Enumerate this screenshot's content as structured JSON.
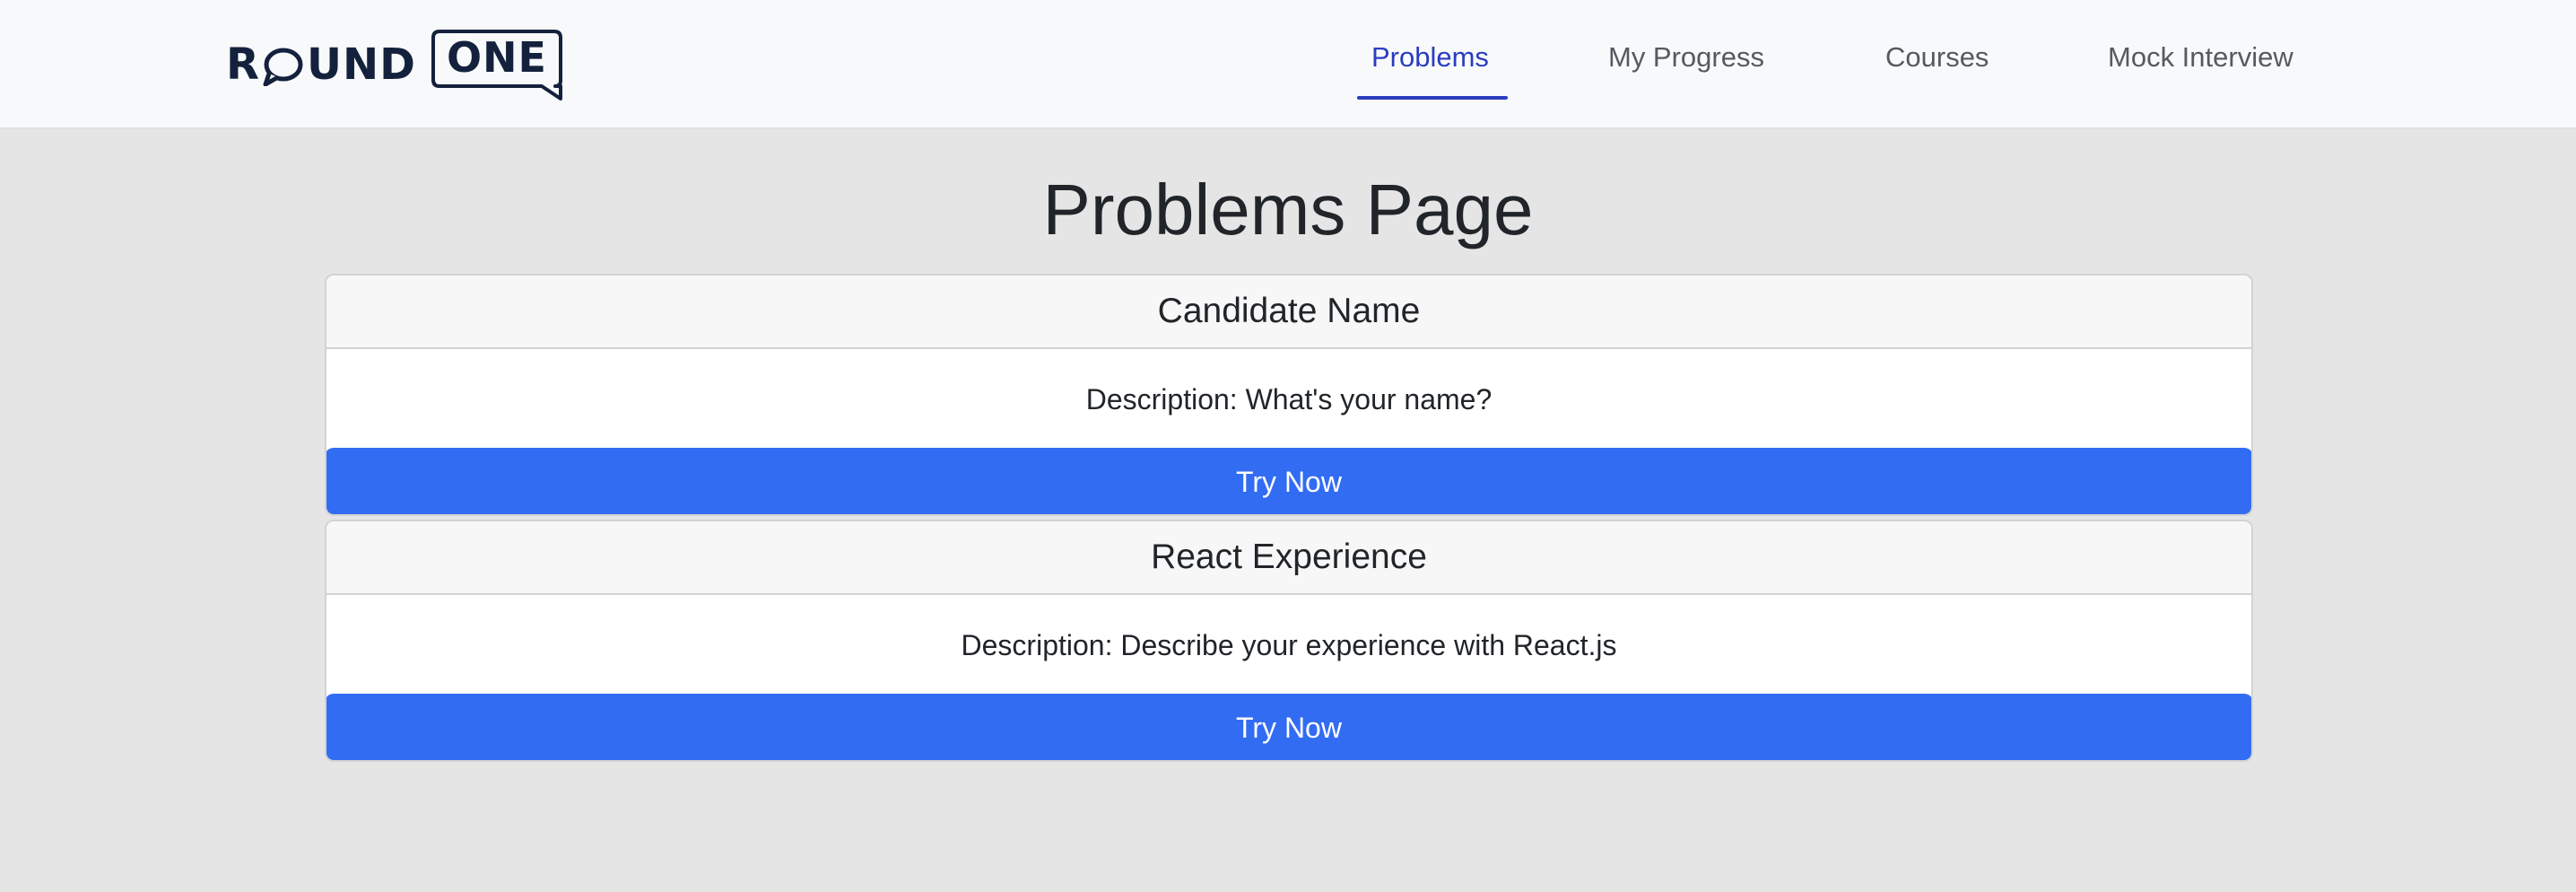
{
  "navbar": {
    "logo": {
      "word_1": "R",
      "word_1_rest": "UND",
      "word_2": "ONE"
    },
    "links": [
      {
        "label": "Problems",
        "active": true
      },
      {
        "label": "My Progress",
        "active": false
      },
      {
        "label": "Courses",
        "active": false
      },
      {
        "label": "Mock Interview",
        "active": false
      }
    ]
  },
  "page": {
    "title": "Problems Page"
  },
  "problems": [
    {
      "title": "Candidate Name",
      "description": "Description: What's your name?",
      "button_label": "Try Now"
    },
    {
      "title": "React Experience",
      "description": "Description: Describe your experience with React.js",
      "button_label": "Try Now"
    }
  ],
  "colors": {
    "navbar_bg": "#f8f9fa",
    "page_bg": "#e5e5e5",
    "active_link": "#2a3dbf",
    "primary_button": "#326cf3",
    "logo_dark": "#14213d"
  }
}
